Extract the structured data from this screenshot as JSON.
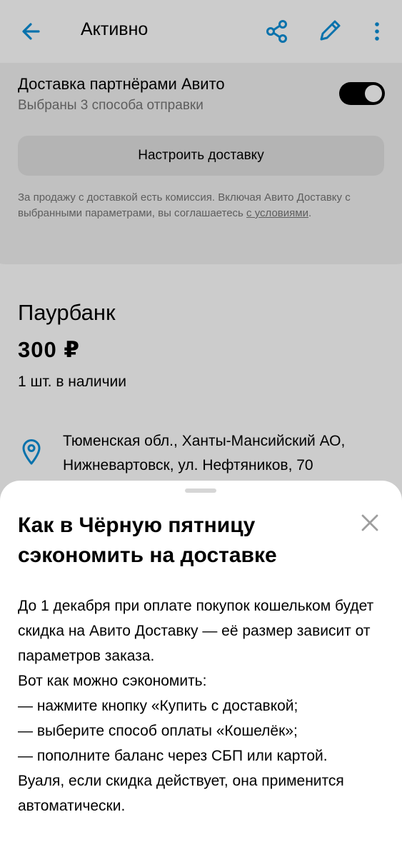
{
  "colors": {
    "accent": "#0a8fd8",
    "background": "#ffffff",
    "secondary_text": "#757575",
    "toggle_on": "#000000",
    "overlay": "rgba(0,0,0,0.20)"
  },
  "header": {
    "title": "Активно",
    "icons": [
      "back-arrow-icon",
      "share-icon",
      "edit-pencil-icon",
      "more-vert-icon"
    ]
  },
  "delivery": {
    "title": "Доставка партнёрами Авито",
    "subtitle": "Выбраны 3 способа отправки",
    "toggle_on": true,
    "setup_button": "Настроить доставку",
    "fine_print": "За продажу с доставкой есть комиссия. Включая Авито Доставку с выбранными параметрами, вы соглашаетесь ",
    "fine_print_link": "с условиями",
    "fine_print_end": "."
  },
  "product": {
    "name": "Паурбанк",
    "price": "300 ₽",
    "stock": "1 шт. в наличии",
    "location": "Тюменская обл., Ханты-Мансийский АО, Нижневартовск, ул. Нефтяников, 70"
  },
  "sheet": {
    "title": "Как в Чёрную пятницу сэкономить на доставке",
    "body": "До 1 декабря при оплате покупок кошельком будет скидка на Авито Доставку — её размер зависит от параметров заказа.\nВот как можно сэкономить:\n— нажмите кнопку «Купить с доставкой;\n— выберите способ оплаты «Кошелёк»;\n— пополните баланс через СБП или картой.\nВуаля, если скидка действует, она применится автоматически."
  }
}
